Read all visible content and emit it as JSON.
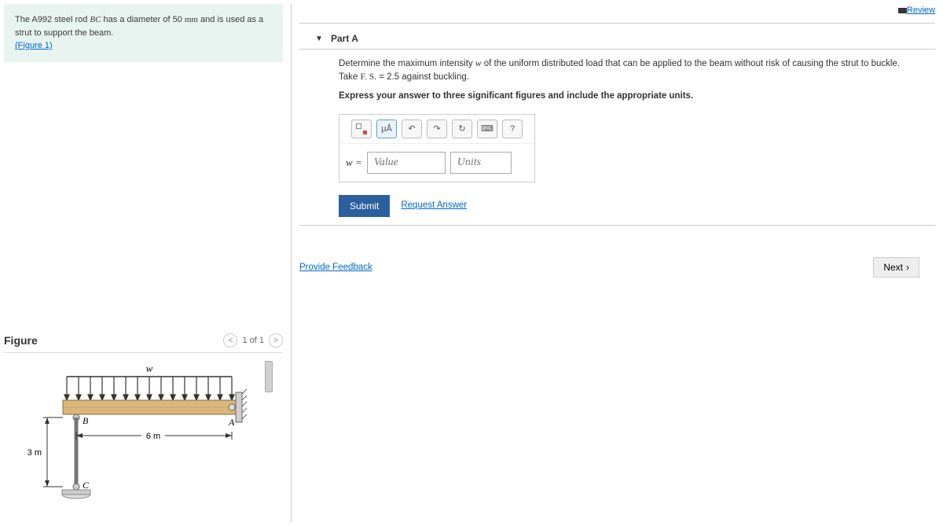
{
  "problem": {
    "text_before": "The A992 steel rod ",
    "rod": "BC",
    "text_mid": " has a diameter of 50 ",
    "unit_mm": "mm",
    "text_after": " and is used as a strut to support the beam.",
    "figure_link": "(Figure 1)"
  },
  "figure": {
    "title": "Figure",
    "page": "1 of 1",
    "labels": {
      "w": "w",
      "B": "B",
      "A": "A",
      "C": "C",
      "len_h": "6 m",
      "len_v": "3 m"
    }
  },
  "review": "Review",
  "partA": {
    "title": "Part A",
    "desc_1": "Determine the maximum intensity ",
    "w": "w",
    "desc_2": " of the uniform distributed load that can be applied to the beam without risk of causing the strut to buckle. Take ",
    "fs": "F. S.",
    "desc_3": " = 2.5 against buckling.",
    "instruct": "Express your answer to three significant figures and include the appropriate units.",
    "tool_mu": "μÅ",
    "tool_undo": "↶",
    "tool_redo": "↷",
    "tool_reset": "↻",
    "tool_kb": "⌨",
    "tool_help": "?",
    "w_eq": "w =",
    "value_ph": "Value",
    "units_ph": "Units",
    "submit": "Submit",
    "request": "Request Answer"
  },
  "feedback": "Provide Feedback",
  "next": "Next"
}
